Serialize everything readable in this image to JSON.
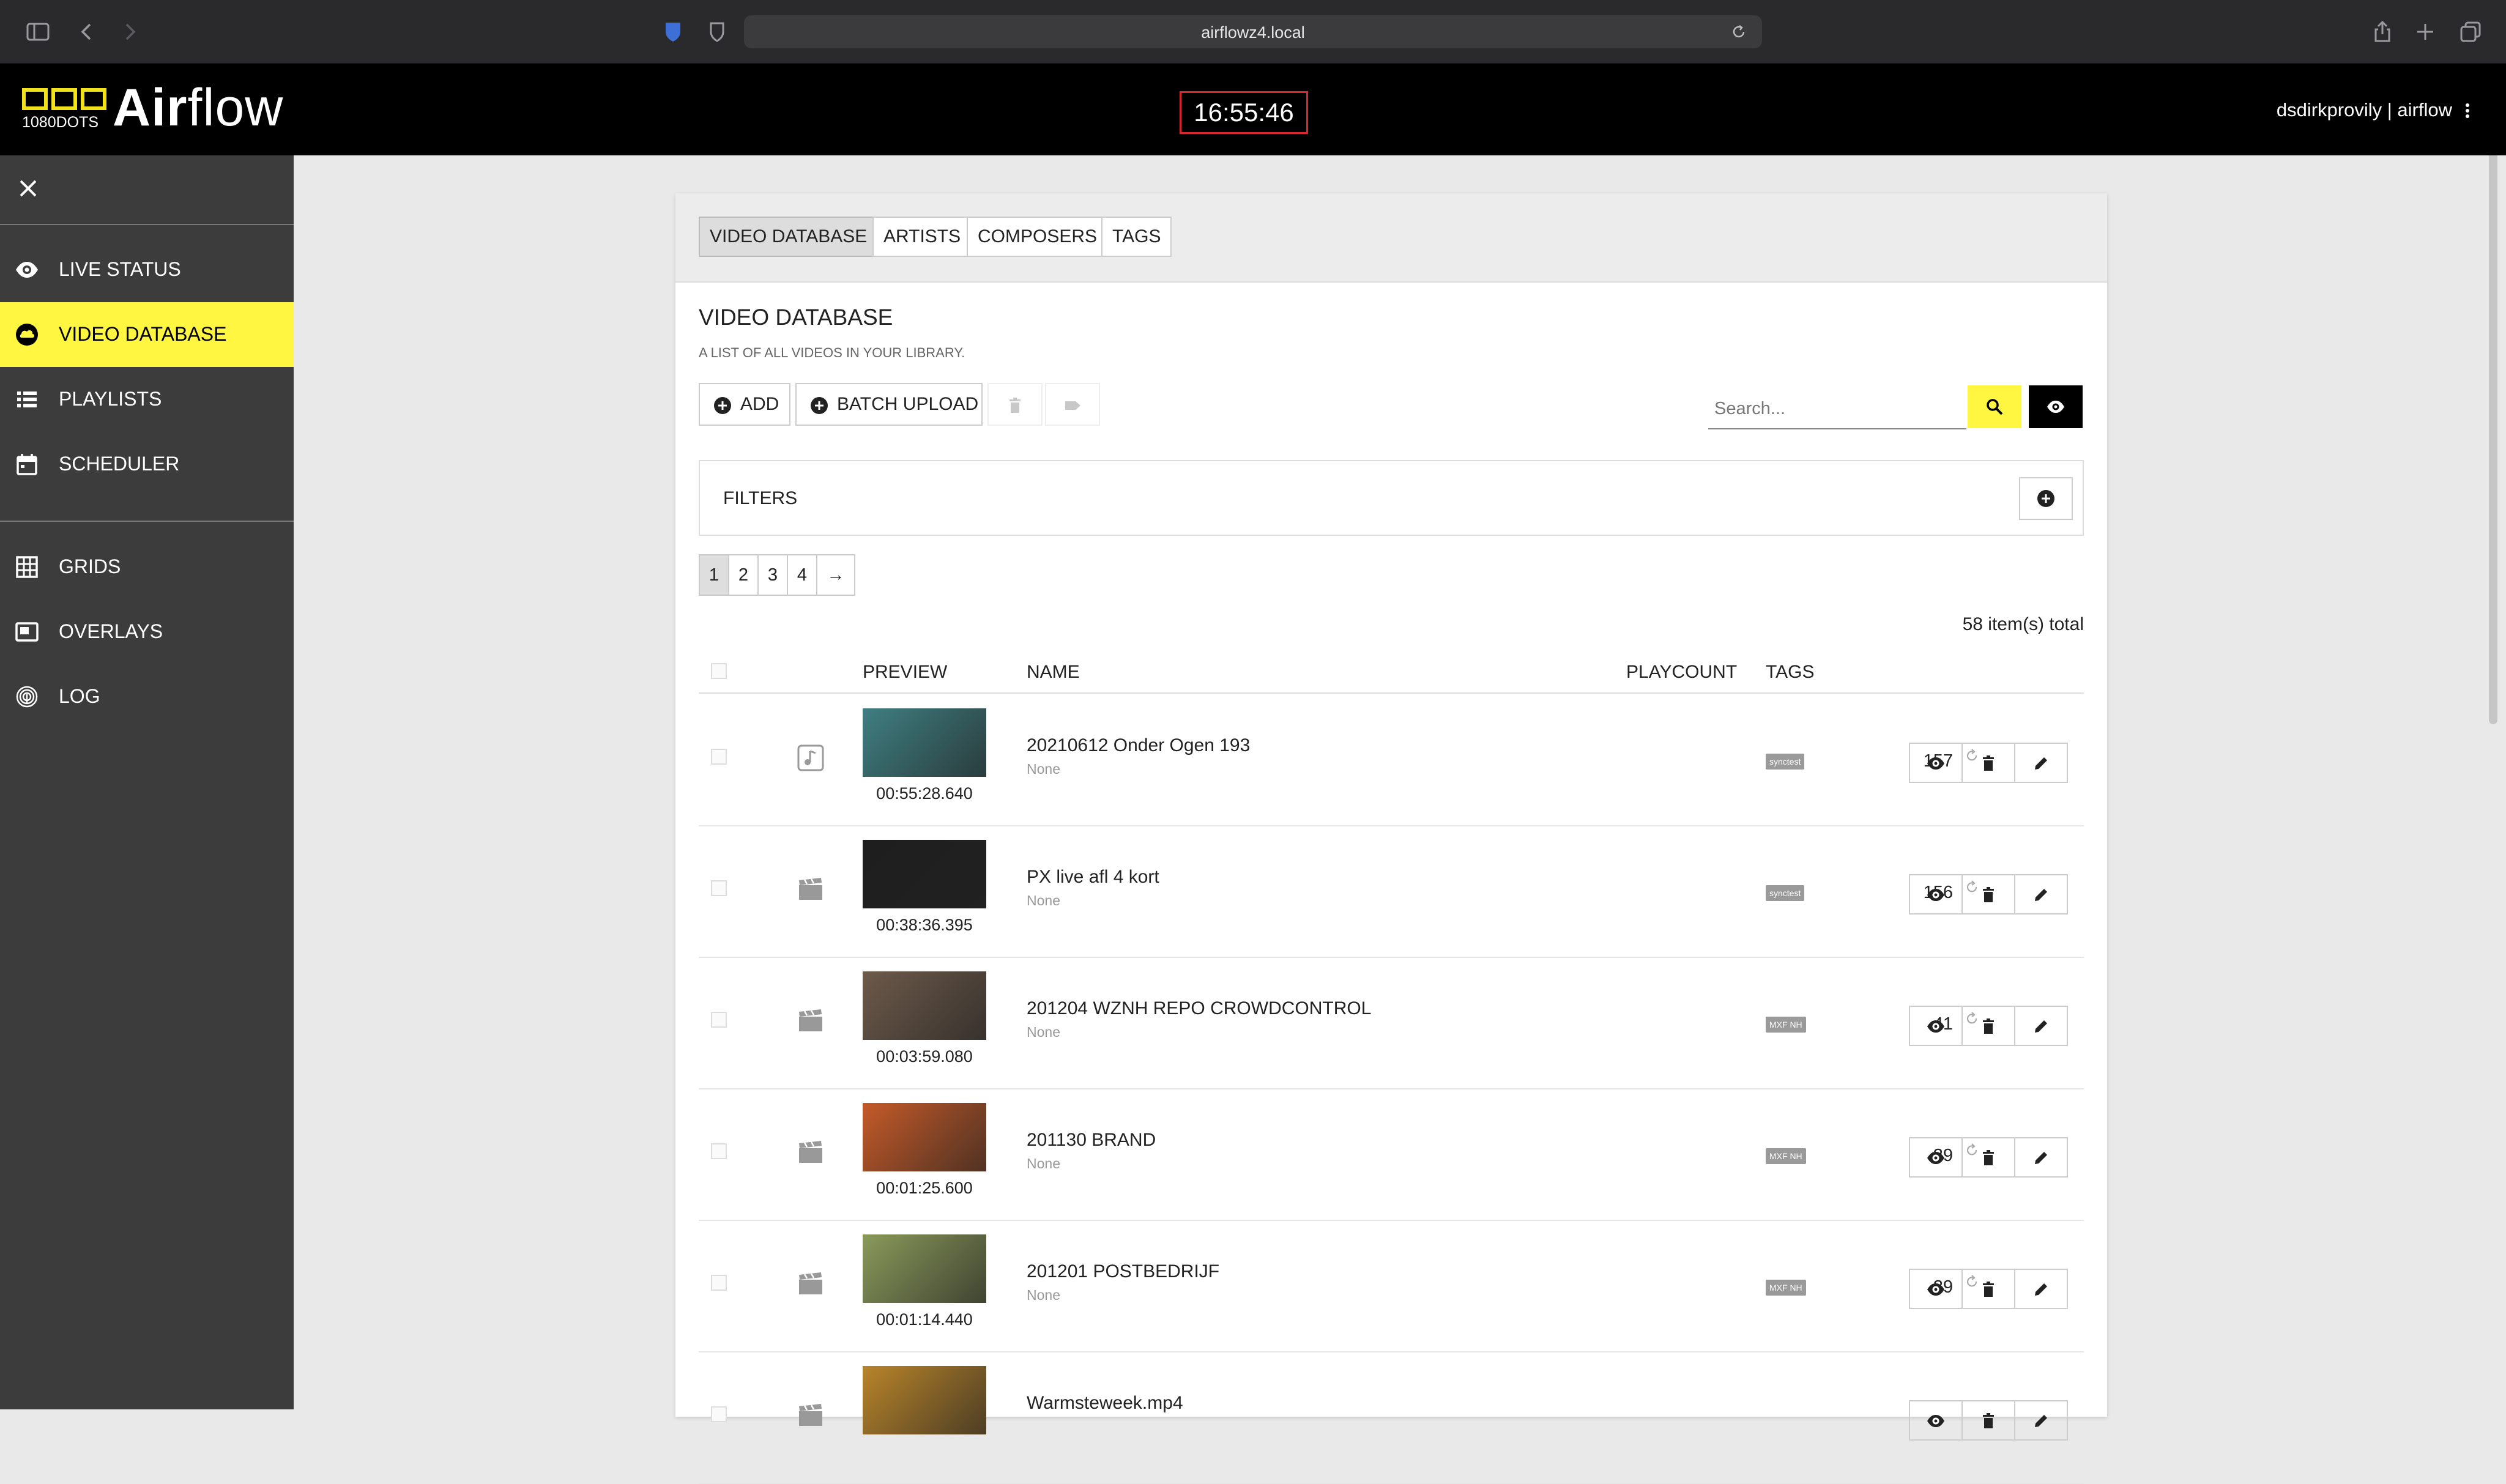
{
  "browser": {
    "url": "airflowz4.local"
  },
  "header": {
    "brand_bold": "Air",
    "brand_light": "flow",
    "logo_text": "1080DOTS",
    "clock": "16:55:46",
    "user": "dsdirkprovily | airflow"
  },
  "sidebar": {
    "items": [
      {
        "label": "LIVE STATUS",
        "icon": "eye-icon"
      },
      {
        "label": "VIDEO DATABASE",
        "icon": "cloud-icon",
        "active": true
      },
      {
        "label": "PLAYLISTS",
        "icon": "list-icon"
      },
      {
        "label": "SCHEDULER",
        "icon": "calendar-icon"
      },
      {
        "label": "GRIDS",
        "icon": "grid-icon"
      },
      {
        "label": "OVERLAYS",
        "icon": "overlay-icon"
      },
      {
        "label": "LOG",
        "icon": "fingerprint-icon"
      }
    ]
  },
  "tabs": [
    {
      "label": "VIDEO DATABASE",
      "selected": true
    },
    {
      "label": "ARTISTS"
    },
    {
      "label": "COMPOSERS"
    },
    {
      "label": "TAGS"
    }
  ],
  "page": {
    "title": "VIDEO DATABASE",
    "subtitle": "A LIST OF ALL VIDEOS IN YOUR LIBRARY."
  },
  "toolbar": {
    "add_label": "ADD",
    "batch_label": "BATCH UPLOAD",
    "search_placeholder": "Search..."
  },
  "filters": {
    "label": "FILTERS"
  },
  "pagination": {
    "pages": [
      "1",
      "2",
      "3",
      "4"
    ],
    "current": "1",
    "next": "→"
  },
  "total": "58 item(s) total",
  "columns": {
    "preview": "PREVIEW",
    "name": "NAME",
    "playcount": "PLAYCOUNT",
    "tags": "TAGS"
  },
  "rows": [
    {
      "type": "audio",
      "duration": "00:55:28.640",
      "name": "20210612 Onder Ogen 193",
      "artist": "None",
      "playcount": "157",
      "tag": "synctest",
      "thumb_color": "#3f7f82"
    },
    {
      "type": "video",
      "duration": "00:38:36.395",
      "name": "PX live afl 4 kort",
      "artist": "None",
      "playcount": "156",
      "tag": "synctest",
      "thumb_color": "#1e1e1e"
    },
    {
      "type": "video",
      "duration": "00:03:59.080",
      "name": "201204 WZNH REPO CROWDCONTROL",
      "artist": "None",
      "playcount": "41",
      "tag": "MXF NH",
      "thumb_color": "#6d5a4a"
    },
    {
      "type": "video",
      "duration": "00:01:25.600",
      "name": "201130 BRAND",
      "artist": "None",
      "playcount": "39",
      "tag": "MXF NH",
      "thumb_color": "#c45a28"
    },
    {
      "type": "video",
      "duration": "00:01:14.440",
      "name": "201201 POSTBEDRIJF",
      "artist": "None",
      "playcount": "39",
      "tag": "MXF NH",
      "thumb_color": "#8a9a5a"
    },
    {
      "type": "video",
      "duration": "",
      "name": "Warmsteweek.mp4",
      "artist": "",
      "playcount": "",
      "tag": "",
      "thumb_color": "#b8842a"
    }
  ],
  "colors": {
    "accent": "#fff642",
    "header_bg": "#000000",
    "sidebar_bg": "#3c3c3c",
    "clock_border": "#d8272d"
  }
}
